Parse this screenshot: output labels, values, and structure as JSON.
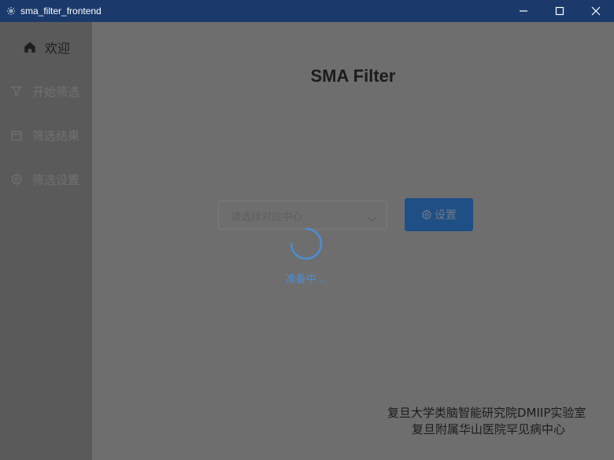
{
  "window": {
    "title": "sma_filter_frontend",
    "controls": {
      "minimize_icon": "minimize-icon",
      "maximize_icon": "maximize-icon",
      "close_icon": "close-icon"
    }
  },
  "sidebar": {
    "items": [
      {
        "label": "欢迎",
        "icon": "home-icon",
        "active": true
      },
      {
        "label": "开始筛选",
        "icon": "filter-icon",
        "active": false
      },
      {
        "label": "筛选结果",
        "icon": "calendar-icon",
        "active": false
      },
      {
        "label": "筛选设置",
        "icon": "gear-icon",
        "active": false
      }
    ]
  },
  "main": {
    "title": "SMA Filter",
    "center_select": {
      "placeholder": "请选择对应中心"
    },
    "settings_button": {
      "label": "设置",
      "icon": "gear-icon"
    },
    "loading": {
      "text": "准备中..."
    },
    "footer": {
      "line1": "复旦大学类脑智能研究院DMIIP实验室",
      "line2": "复旦附属华山医院罕见病中心"
    }
  },
  "colors": {
    "titlebar": "#1b3a6b",
    "overlay_main": "#6e6e6e",
    "overlay_sidebar": "#5a5a5a",
    "primary_button": "#1e4f85",
    "loading_accent": "#4a8ed6"
  }
}
